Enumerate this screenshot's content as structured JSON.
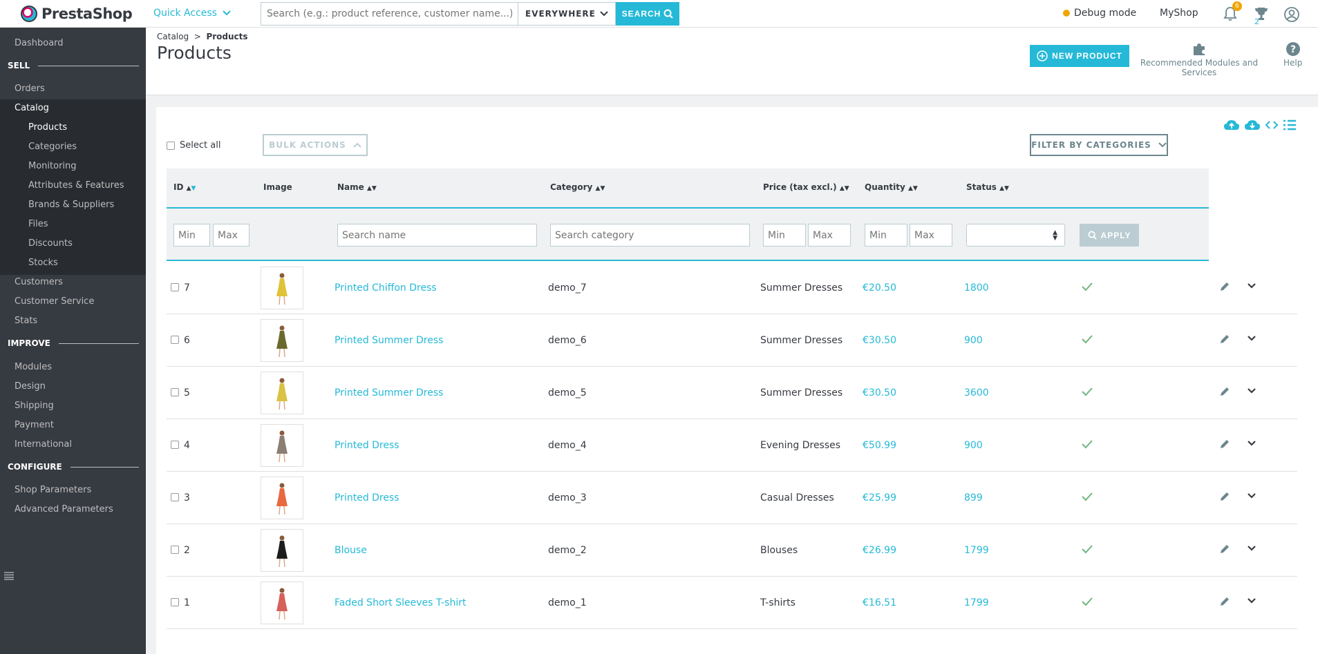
{
  "topbar": {
    "logo_text": "PrestaShop",
    "quick_access": "Quick Access",
    "search_placeholder": "Search (e.g.: product reference, customer name...)",
    "search_scope": "EVERYWHERE",
    "search_button": "SEARCH",
    "debug_mode": "Debug mode",
    "shop_name": "MyShop",
    "notifications_count": "6",
    "trophy_count": "2"
  },
  "sidebar": {
    "dashboard": "Dashboard",
    "sections": {
      "sell": "SELL",
      "improve": "IMPROVE",
      "configure": "CONFIGURE"
    },
    "sell_items": [
      "Orders",
      "Catalog",
      "Customers",
      "Customer Service",
      "Stats"
    ],
    "catalog_sub": [
      "Products",
      "Categories",
      "Monitoring",
      "Attributes & Features",
      "Brands & Suppliers",
      "Files",
      "Discounts",
      "Stocks"
    ],
    "improve_items": [
      "Modules",
      "Design",
      "Shipping",
      "Payment",
      "International"
    ],
    "configure_items": [
      "Shop Parameters",
      "Advanced Parameters"
    ]
  },
  "header": {
    "breadcrumb_parent": "Catalog",
    "breadcrumb_sep": ">",
    "breadcrumb_current": "Products",
    "title": "Products",
    "new_product": "NEW PRODUCT",
    "recommended": "Recommended Modules and Services",
    "help": "Help"
  },
  "toolbar": {
    "select_all": "Select all",
    "bulk_actions": "BULK ACTIONS",
    "filter_categories": "FILTER BY CATEGORIES"
  },
  "table": {
    "columns": {
      "id": "ID",
      "image": "Image",
      "name": "Name",
      "category": "Category",
      "price": "Price (tax excl.)",
      "quantity": "Quantity",
      "status": "Status"
    },
    "filters": {
      "min": "Min",
      "max": "Max",
      "search_name": "Search name",
      "search_category": "Search category",
      "apply": "APPLY"
    },
    "rows": [
      {
        "id": "7",
        "name": "Printed Chiffon Dress",
        "reference": "demo_7",
        "category": "Summer Dresses",
        "price": "€20.50",
        "quantity": "1800",
        "dress_color": "#e0c23a"
      },
      {
        "id": "6",
        "name": "Printed Summer Dress",
        "reference": "demo_6",
        "category": "Summer Dresses",
        "price": "€30.50",
        "quantity": "900",
        "dress_color": "#6b6a2e"
      },
      {
        "id": "5",
        "name": "Printed Summer Dress",
        "reference": "demo_5",
        "category": "Summer Dresses",
        "price": "€30.50",
        "quantity": "3600",
        "dress_color": "#d9c244"
      },
      {
        "id": "4",
        "name": "Printed Dress",
        "reference": "demo_4",
        "category": "Evening Dresses",
        "price": "€50.99",
        "quantity": "900",
        "dress_color": "#8a7f72"
      },
      {
        "id": "3",
        "name": "Printed Dress",
        "reference": "demo_3",
        "category": "Casual Dresses",
        "price": "€25.99",
        "quantity": "899",
        "dress_color": "#e8683f"
      },
      {
        "id": "2",
        "name": "Blouse",
        "reference": "demo_2",
        "category": "Blouses",
        "price": "€26.99",
        "quantity": "1799",
        "dress_color": "#1d1d1d"
      },
      {
        "id": "1",
        "name": "Faded Short Sleeves T-shirt",
        "reference": "demo_1",
        "category": "T-shirts",
        "price": "€16.51",
        "quantity": "1799",
        "dress_color": "#d6605a"
      }
    ]
  },
  "colors": {
    "accent": "#25b9d7",
    "success": "#70b580",
    "sidebar_bg": "#363a41",
    "pink": "#df0067"
  }
}
